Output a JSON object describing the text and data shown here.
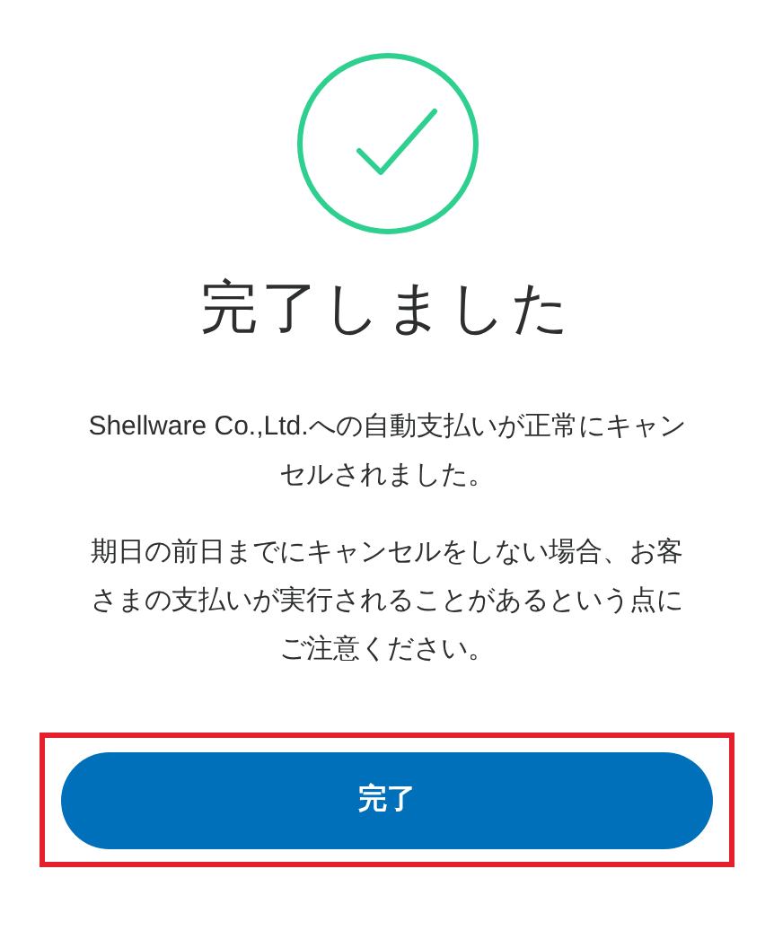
{
  "title": "完了しました",
  "messages": [
    "Shellware Co.,Ltd.への自動支払いが正常にキャンセルされました。",
    "期日の前日までにキャンセルをしない場合、お客さまの支払いが実行されることがあるという点にご注意ください。"
  ],
  "button": {
    "label": "完了"
  }
}
